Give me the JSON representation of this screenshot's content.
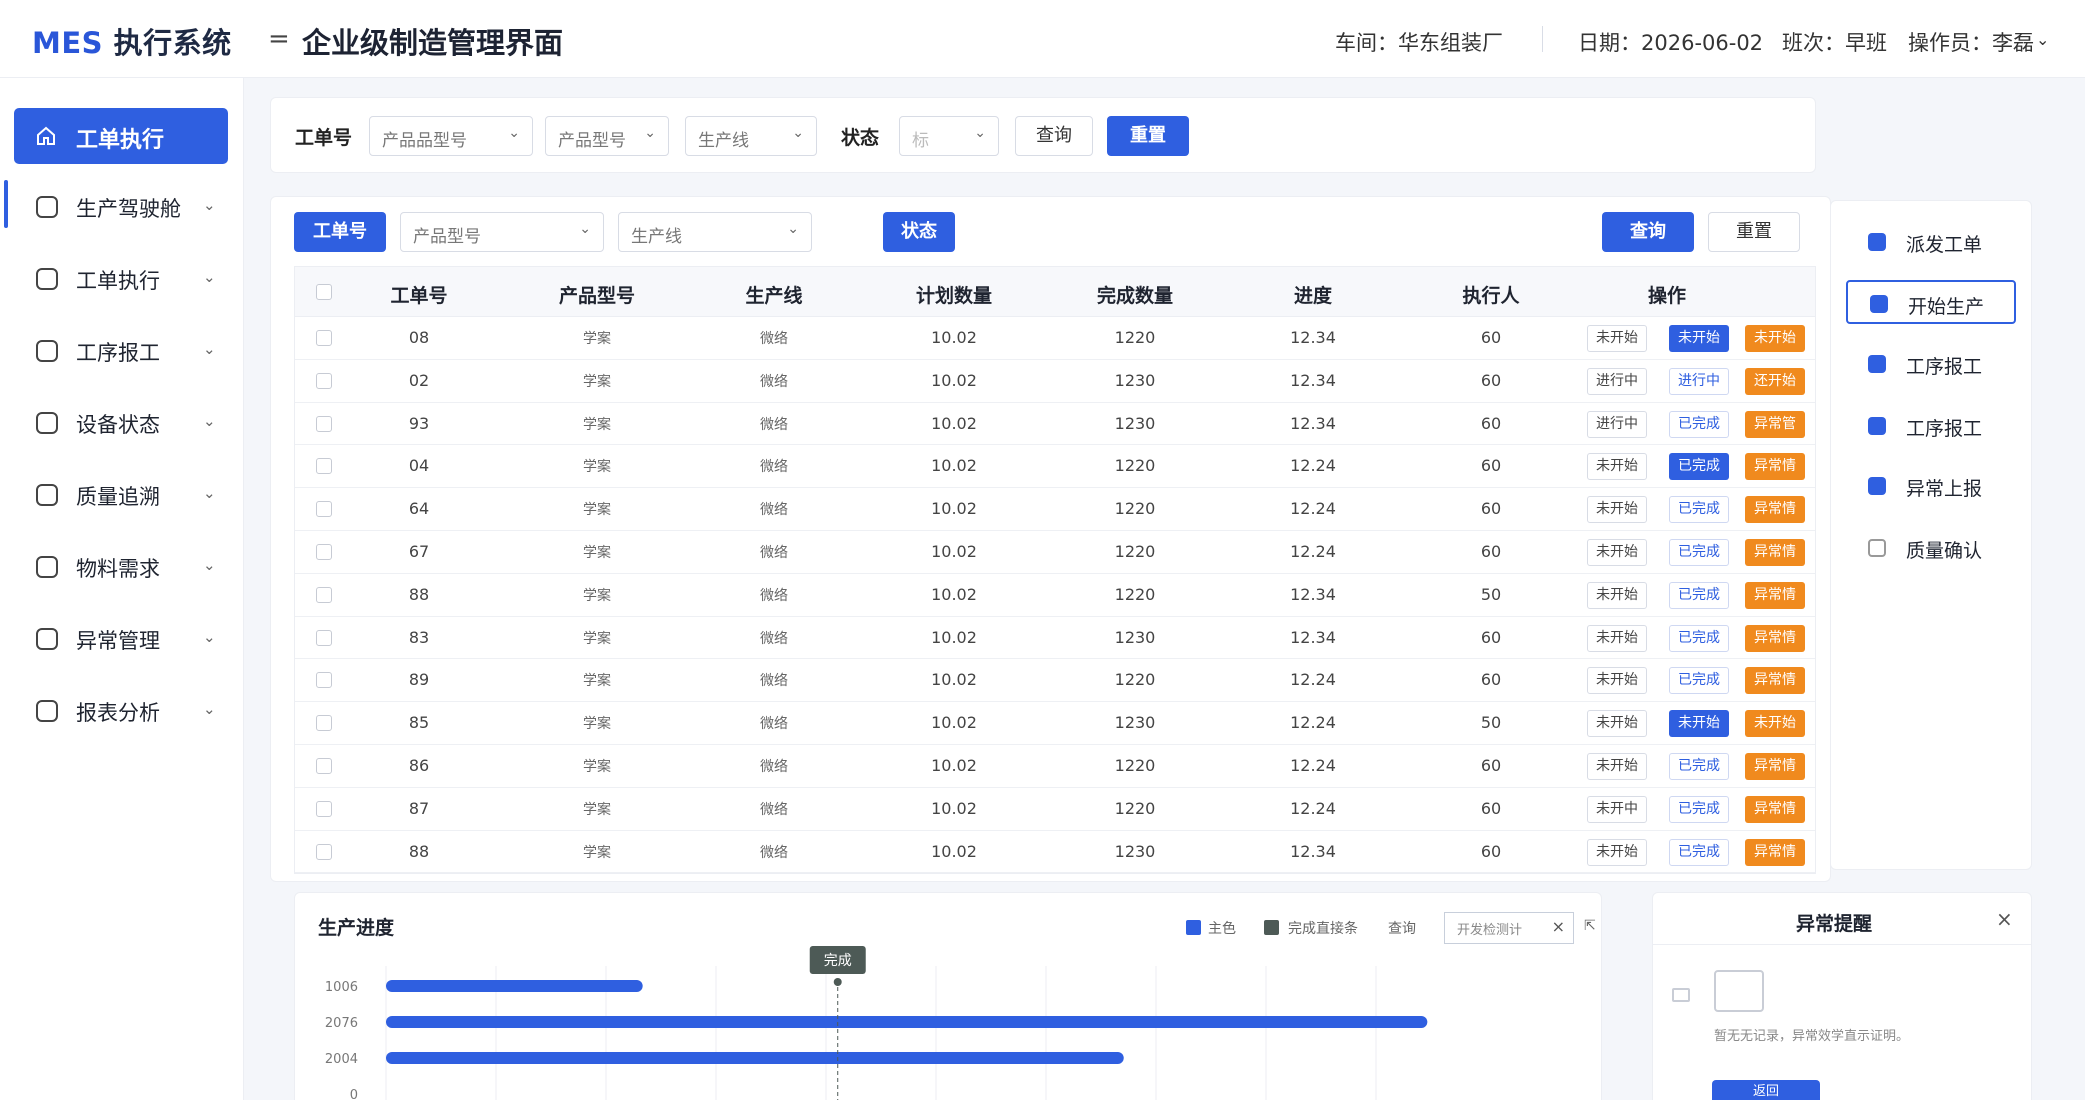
{
  "header": {
    "logo_en": "MES",
    "logo_cn": "执行系统",
    "menu_toggle": "=",
    "page_title": "企业级制造管理界面",
    "workshop": "车间：华东组装厂",
    "date": "日期：2026-06-02",
    "shift": "班次：早班",
    "operator": "操作员：李磊"
  },
  "sidebar": {
    "active": {
      "label": "工单执行",
      "icon": "home-icon"
    },
    "items": [
      {
        "label": "生产驾驶舱",
        "icon": "dashboard-icon"
      },
      {
        "label": "工单执行",
        "icon": "workorder-icon"
      },
      {
        "label": "工序报工",
        "icon": "report-icon"
      },
      {
        "label": "设备状态",
        "icon": "device-icon"
      },
      {
        "label": "质量追溯",
        "icon": "quality-icon"
      },
      {
        "label": "物料需求",
        "icon": "material-icon"
      },
      {
        "label": "异常管理",
        "icon": "alert-icon"
      },
      {
        "label": "报表分析",
        "icon": "analysis-icon"
      }
    ]
  },
  "filter1": {
    "workorder_label": "工单号",
    "product_type": "产品品型号",
    "product_model": "产品型号",
    "line": "生产线",
    "status_label": "状态",
    "status_value": "标",
    "query": "查询",
    "reset": "重置"
  },
  "filter2": {
    "workorder_btn": "工单号",
    "product_model": "产品型号",
    "line": "生产线",
    "status_btn": "状态",
    "query": "查询",
    "reset": "重置"
  },
  "table": {
    "columns": [
      "工单号",
      "产品型号",
      "生产线",
      "计划数量",
      "完成数量",
      "进度",
      "执行人",
      "操作"
    ],
    "rows": [
      {
        "id": "08",
        "model": "学案",
        "line": "微络",
        "plan": "10.02",
        "done": "1220",
        "progress": "12.34",
        "owner": "60",
        "state": "未开始",
        "a1": "未开始",
        "a1type": "blue",
        "a2": "未开始"
      },
      {
        "id": "02",
        "model": "学案",
        "line": "微络",
        "plan": "10.02",
        "done": "1230",
        "progress": "12.34",
        "owner": "60",
        "state": "进行中",
        "a1": "进行中",
        "a1type": "outline",
        "a2": "还开始"
      },
      {
        "id": "93",
        "model": "学案",
        "line": "微络",
        "plan": "10.02",
        "done": "1230",
        "progress": "12.34",
        "owner": "60",
        "state": "进行中",
        "a1": "已完成",
        "a1type": "outline",
        "a2": "异常管"
      },
      {
        "id": "04",
        "model": "学案",
        "line": "微络",
        "plan": "10.02",
        "done": "1220",
        "progress": "12.24",
        "owner": "60",
        "state": "未开始",
        "a1": "已完成",
        "a1type": "blue",
        "a2": "异常情"
      },
      {
        "id": "64",
        "model": "学案",
        "line": "微络",
        "plan": "10.02",
        "done": "1220",
        "progress": "12.24",
        "owner": "60",
        "state": "未开始",
        "a1": "已完成",
        "a1type": "outline",
        "a2": "异常情"
      },
      {
        "id": "67",
        "model": "学案",
        "line": "微络",
        "plan": "10.02",
        "done": "1220",
        "progress": "12.24",
        "owner": "60",
        "state": "未开始",
        "a1": "已完成",
        "a1type": "outline",
        "a2": "异常情"
      },
      {
        "id": "88",
        "model": "学案",
        "line": "微络",
        "plan": "10.02",
        "done": "1220",
        "progress": "12.34",
        "owner": "50",
        "state": "未开始",
        "a1": "已完成",
        "a1type": "outline",
        "a2": "异常情"
      },
      {
        "id": "83",
        "model": "学案",
        "line": "微络",
        "plan": "10.02",
        "done": "1230",
        "progress": "12.34",
        "owner": "60",
        "state": "未开始",
        "a1": "已完成",
        "a1type": "outline",
        "a2": "异常情"
      },
      {
        "id": "89",
        "model": "学案",
        "line": "微络",
        "plan": "10.02",
        "done": "1220",
        "progress": "12.24",
        "owner": "60",
        "state": "未开始",
        "a1": "已完成",
        "a1type": "outline",
        "a2": "异常情"
      },
      {
        "id": "85",
        "model": "学案",
        "line": "微络",
        "plan": "10.02",
        "done": "1230",
        "progress": "12.24",
        "owner": "50",
        "state": "未开始",
        "a1": "未开始",
        "a1type": "blue",
        "a2": "未开始"
      },
      {
        "id": "86",
        "model": "学案",
        "line": "微络",
        "plan": "10.02",
        "done": "1220",
        "progress": "12.24",
        "owner": "60",
        "state": "未开始",
        "a1": "已完成",
        "a1type": "outline",
        "a2": "异常情"
      },
      {
        "id": "87",
        "model": "学案",
        "line": "微络",
        "plan": "10.02",
        "done": "1220",
        "progress": "12.24",
        "owner": "60",
        "state": "未开中",
        "a1": "已完成",
        "a1type": "outline",
        "a2": "异常情"
      },
      {
        "id": "88",
        "model": "学案",
        "line": "微络",
        "plan": "10.02",
        "done": "1230",
        "progress": "12.34",
        "owner": "60",
        "state": "未开始",
        "a1": "已完成",
        "a1type": "outline",
        "a2": "异常情"
      }
    ]
  },
  "actions": [
    {
      "label": "派发工单",
      "active": false
    },
    {
      "label": "开始生产",
      "active": true
    },
    {
      "label": "工序报工",
      "active": false
    },
    {
      "label": "工序报工",
      "active": false
    },
    {
      "label": "异常上报",
      "active": false
    },
    {
      "label": "质量确认",
      "active": false,
      "outline": true
    }
  ],
  "progress_panel": {
    "title": "生产进度",
    "legend": [
      {
        "label": "主色",
        "color": "#2f5fe0"
      },
      {
        "label": "完成直接条",
        "color": "#4d5a56"
      }
    ],
    "legend_extra": "查询",
    "search_placeholder": "开发检测计",
    "marker_label": "完成"
  },
  "chart_data": {
    "type": "bar",
    "orientation": "horizontal",
    "categories": [
      "1006",
      "2076",
      "2004",
      "0"
    ],
    "values": [
      175,
      710,
      503,
      0
    ],
    "xlim": [
      0,
      900
    ],
    "marker_x": 308,
    "marker_label": "完成",
    "color": "#2f5fe0"
  },
  "alert_panel": {
    "title": "异常提醒",
    "close": "×",
    "empty_text": "暂无无记录，异常效学直示证明。",
    "button": "返回"
  }
}
